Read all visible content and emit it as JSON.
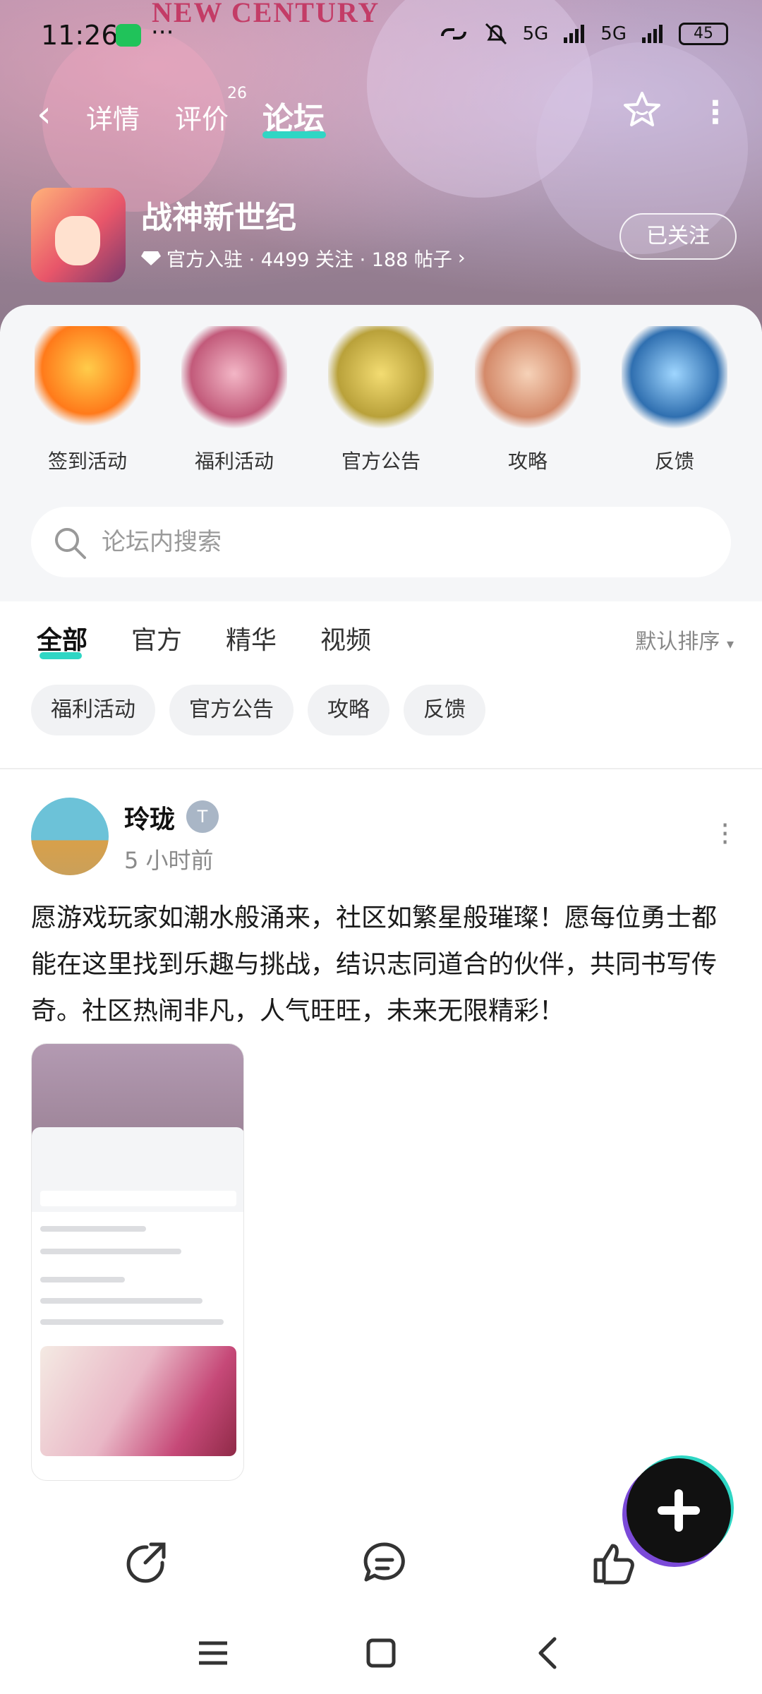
{
  "status_bar": {
    "time": "11:26",
    "more_dots": "···",
    "signal1": "5G",
    "signal2": "5G",
    "battery": "45"
  },
  "banner": {
    "title": "NEW CENTURY"
  },
  "nav": {
    "tabs": [
      {
        "label": "详情"
      },
      {
        "label": "评价",
        "badge": "26"
      },
      {
        "label": "论坛"
      }
    ]
  },
  "game": {
    "name": "战神新世纪",
    "meta": "官方入驻 · 4499 关注 · 188 帖子",
    "follow_label": "已关注"
  },
  "categories": [
    {
      "label": "签到活动"
    },
    {
      "label": "福利活动"
    },
    {
      "label": "官方公告"
    },
    {
      "label": "攻略"
    },
    {
      "label": "反馈"
    }
  ],
  "search": {
    "placeholder": "论坛内搜索"
  },
  "filters": {
    "tabs": [
      {
        "label": "全部"
      },
      {
        "label": "官方"
      },
      {
        "label": "精华"
      },
      {
        "label": "视频"
      }
    ],
    "sort_label": "默认排序"
  },
  "chips": [
    {
      "label": "福利活动"
    },
    {
      "label": "官方公告"
    },
    {
      "label": "攻略"
    },
    {
      "label": "反馈"
    }
  ],
  "post": {
    "author": "玲珑",
    "time": "5 小时前",
    "body": "愿游戏玩家如潮水般涌来，社区如繁星般璀璨！愿每位勇士都能在这里找到乐趣与挑战，结识志同道合的伙伴，共同书写传奇。社区热闹非凡，人气旺旺，未来无限精彩！"
  },
  "colors": {
    "accent": "#2fd6c4",
    "fab": "#111111",
    "banner": "#9c8296"
  }
}
